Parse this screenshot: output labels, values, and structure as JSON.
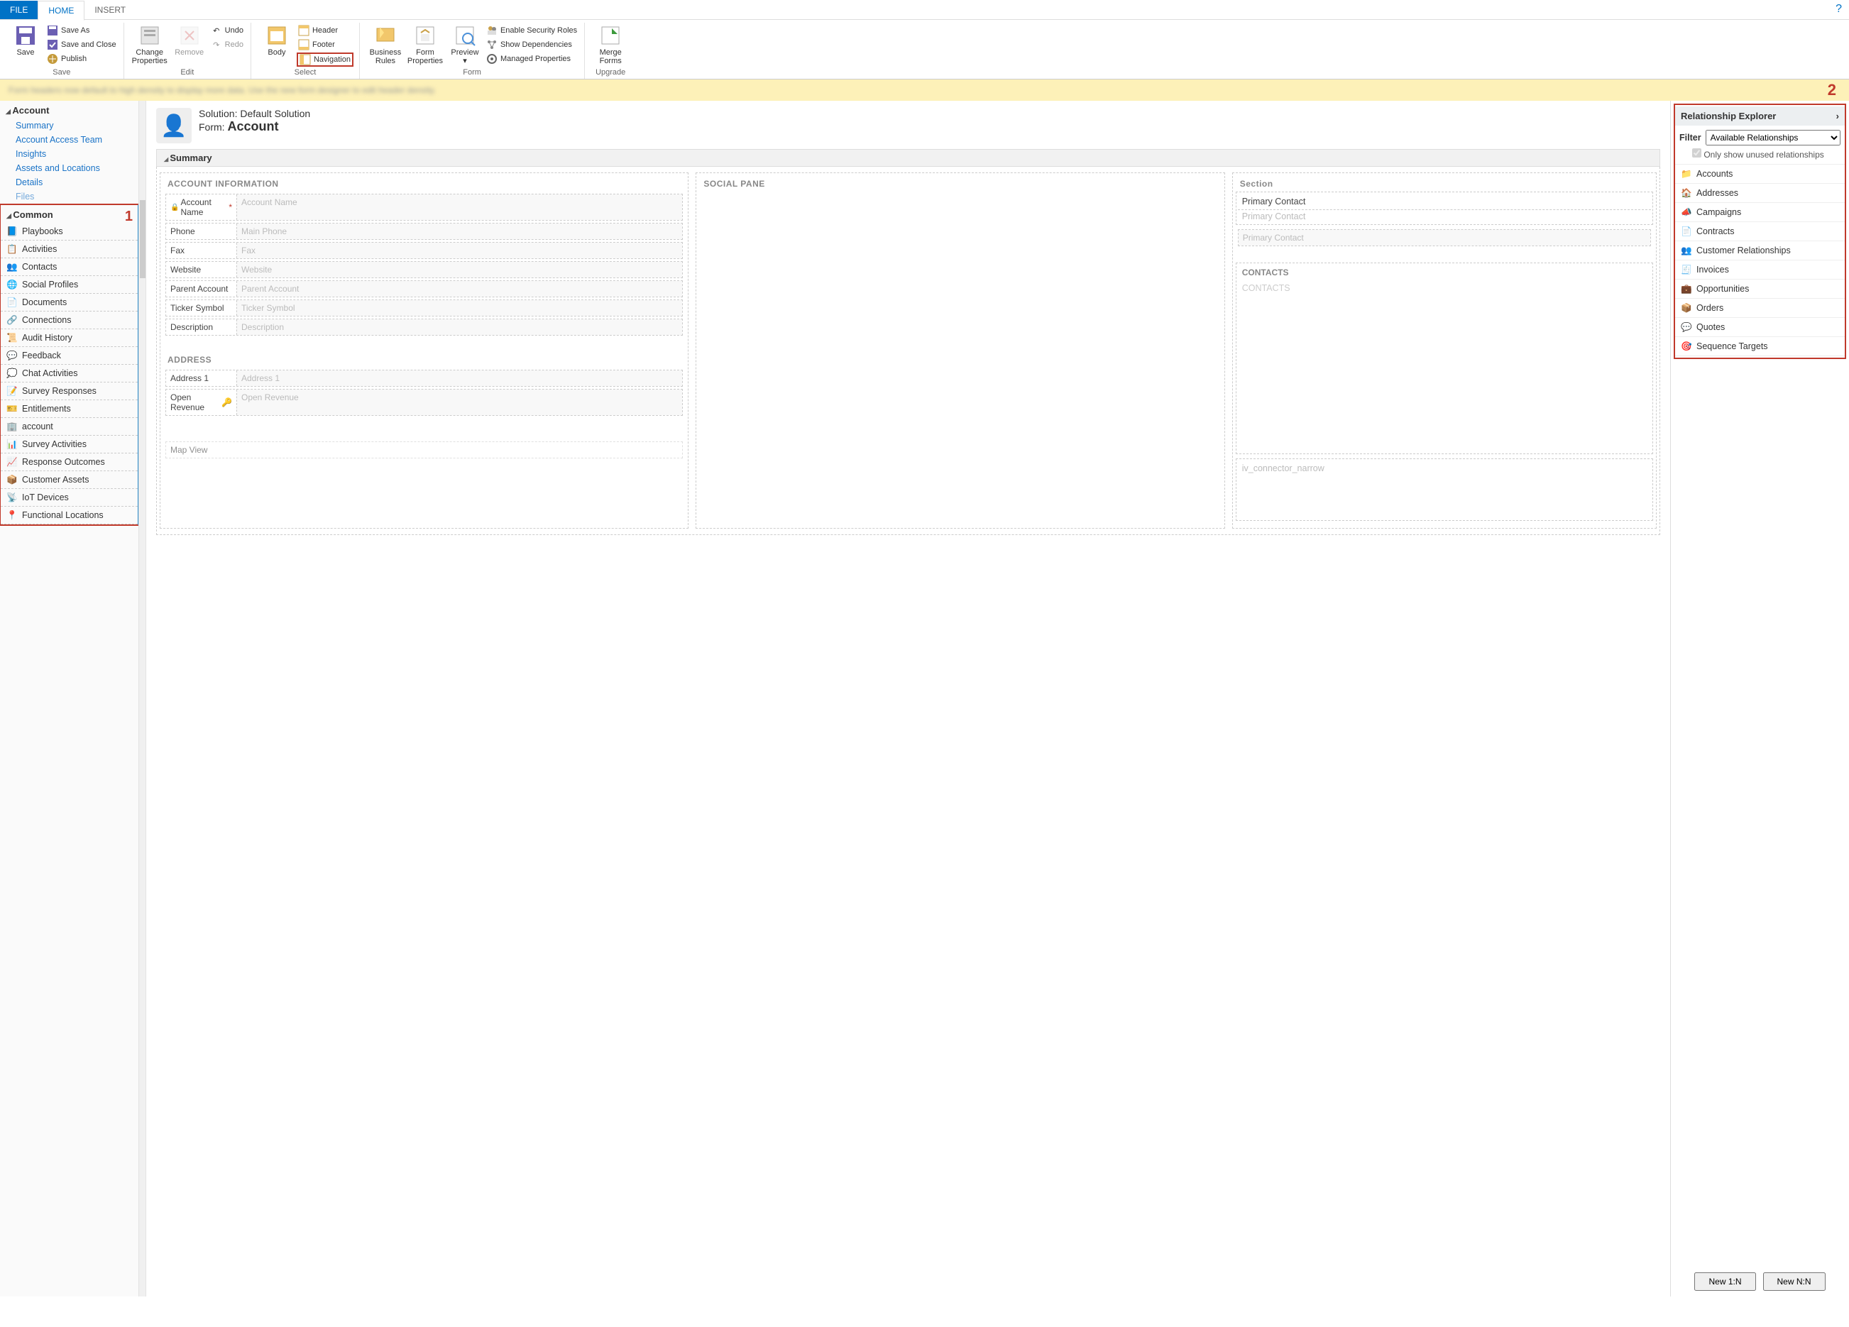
{
  "tabs": {
    "file": "FILE",
    "home": "HOME",
    "insert": "INSERT"
  },
  "ribbon": {
    "save": {
      "big": "Save",
      "saveas": "Save As",
      "saveclose": "Save and Close",
      "publish": "Publish",
      "group": "Save"
    },
    "edit": {
      "change": "Change\nProperties",
      "remove": "Remove",
      "undo": "Undo",
      "redo": "Redo",
      "group": "Edit"
    },
    "select": {
      "body": "Body",
      "header": "Header",
      "footer": "Footer",
      "navigation": "Navigation",
      "group": "Select"
    },
    "form": {
      "brules": "Business\nRules",
      "fprops": "Form\nProperties",
      "preview": "Preview",
      "enable_sec": "Enable Security Roles",
      "show_dep": "Show Dependencies",
      "managed": "Managed Properties",
      "group": "Form"
    },
    "upgrade": {
      "merge": "Merge\nForms",
      "group": "Upgrade"
    }
  },
  "callouts": {
    "one": "1",
    "two": "2"
  },
  "infobar_text": "Form headers now default to high density to display more data. Use the new form designer to edit header density.",
  "formhead": {
    "solution_lbl": "Solution: ",
    "solution": "Default Solution",
    "form_lbl": "Form: ",
    "form": "Account"
  },
  "leftnav": {
    "account_hdr": "Account",
    "account_links": [
      "Summary",
      "Account Access Team",
      "Insights",
      "Assets and Locations",
      "Details",
      "Files"
    ],
    "common_hdr": "Common",
    "common_items": [
      "Playbooks",
      "Activities",
      "Contacts",
      "Social Profiles",
      "Documents",
      "Connections",
      "Audit History",
      "Feedback",
      "Chat Activities",
      "Survey Responses",
      "Entitlements",
      "account",
      "Survey Activities",
      "Response Outcomes",
      "Customer Assets",
      "IoT Devices",
      "Functional Locations"
    ]
  },
  "canvas": {
    "summary": "Summary",
    "acct_info": "ACCOUNT INFORMATION",
    "social": "SOCIAL PANE",
    "section": "Section",
    "contacts_hdr": "CONTACTS",
    "contacts_ph": "CONTACTS",
    "address": "ADDRESS",
    "mapview": "Map View",
    "iv": "iv_connector_narrow",
    "fields": {
      "acct_name": {
        "label": "Account Name",
        "req": "*",
        "ph": "Account Name"
      },
      "phone": {
        "label": "Phone",
        "ph": "Main Phone"
      },
      "fax": {
        "label": "Fax",
        "ph": "Fax"
      },
      "website": {
        "label": "Website",
        "ph": "Website"
      },
      "parent": {
        "label": "Parent Account",
        "ph": "Parent Account"
      },
      "ticker": {
        "label": "Ticker Symbol",
        "ph": "Ticker Symbol"
      },
      "desc": {
        "label": "Description",
        "ph": "Description"
      },
      "addr1": {
        "label": "Address 1",
        "ph": "Address 1"
      },
      "openrev": {
        "label": "Open Revenue",
        "ph": "Open Revenue"
      },
      "primary_lbl": "Primary Contact",
      "primary_ph": "Primary Contact"
    }
  },
  "rightpanel": {
    "header": "Relationship Explorer",
    "filter_lbl": "Filter",
    "filter_val": "Available Relationships",
    "only_unused": "Only show unused relationships",
    "items": [
      "Accounts",
      "Addresses",
      "Campaigns",
      "Contracts",
      "Customer Relationships",
      "Invoices",
      "Opportunities",
      "Orders",
      "Quotes",
      "Sequence Targets"
    ],
    "new1n": "New 1:N",
    "newnn": "New N:N"
  }
}
